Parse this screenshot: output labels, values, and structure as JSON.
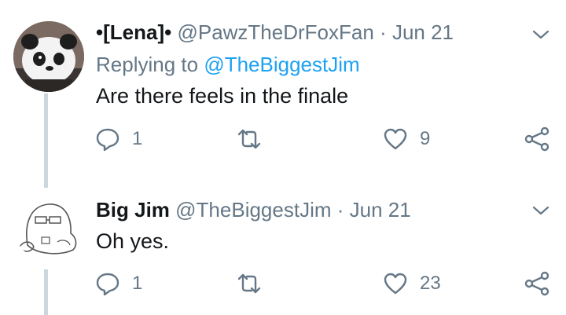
{
  "tweets": [
    {
      "display_name": "•[Lena]•",
      "handle": "@PawzTheDrFoxFan",
      "separator": "·",
      "date": "Jun 21",
      "replying_prefix": "Replying to",
      "replying_to": "@TheBiggestJim",
      "text": "Are there feels in the finale",
      "reply_count": "1",
      "like_count": "9",
      "avatar_icon": "panda-avatar-icon"
    },
    {
      "display_name": "Big Jim",
      "handle": "@TheBiggestJim",
      "separator": "·",
      "date": "Jun 21",
      "text": "Oh yes.",
      "reply_count": "1",
      "like_count": "23",
      "avatar_icon": "sketch-avatar-icon"
    }
  ],
  "colors": {
    "text": "#14171a",
    "secondary": "#657786",
    "link": "#1da1f2",
    "thread_line": "#ccd6dd"
  }
}
